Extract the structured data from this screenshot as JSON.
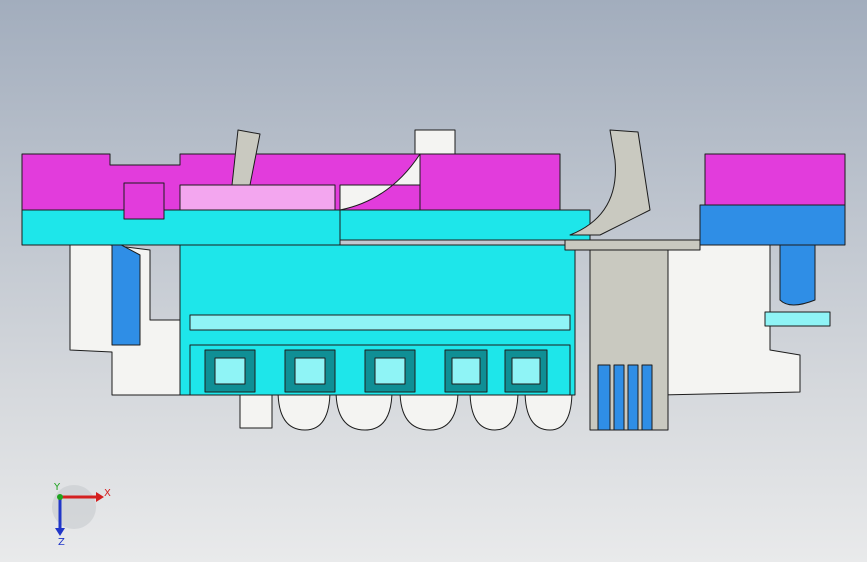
{
  "viewport": {
    "background_top": "#a2adbd",
    "background_bottom": "#e9eaeb"
  },
  "model": {
    "colors": {
      "magenta": "#e23cdc",
      "magenta_light": "#f3a6ef",
      "cyan": "#1ee6ea",
      "cyan_light": "#8ff4f6",
      "blue": "#2f8ee6",
      "white_part": "#f4f4f2",
      "grey_part": "#c9c9c0",
      "teal_dark": "#0f8f95",
      "outline": "#1c1c1c"
    },
    "connector_count": 5
  },
  "triad": {
    "x_label": "X",
    "y_label": "Y",
    "z_label": "Z",
    "x_color": "#d42020",
    "y_color": "#1fa31f",
    "z_color": "#2036c8"
  }
}
